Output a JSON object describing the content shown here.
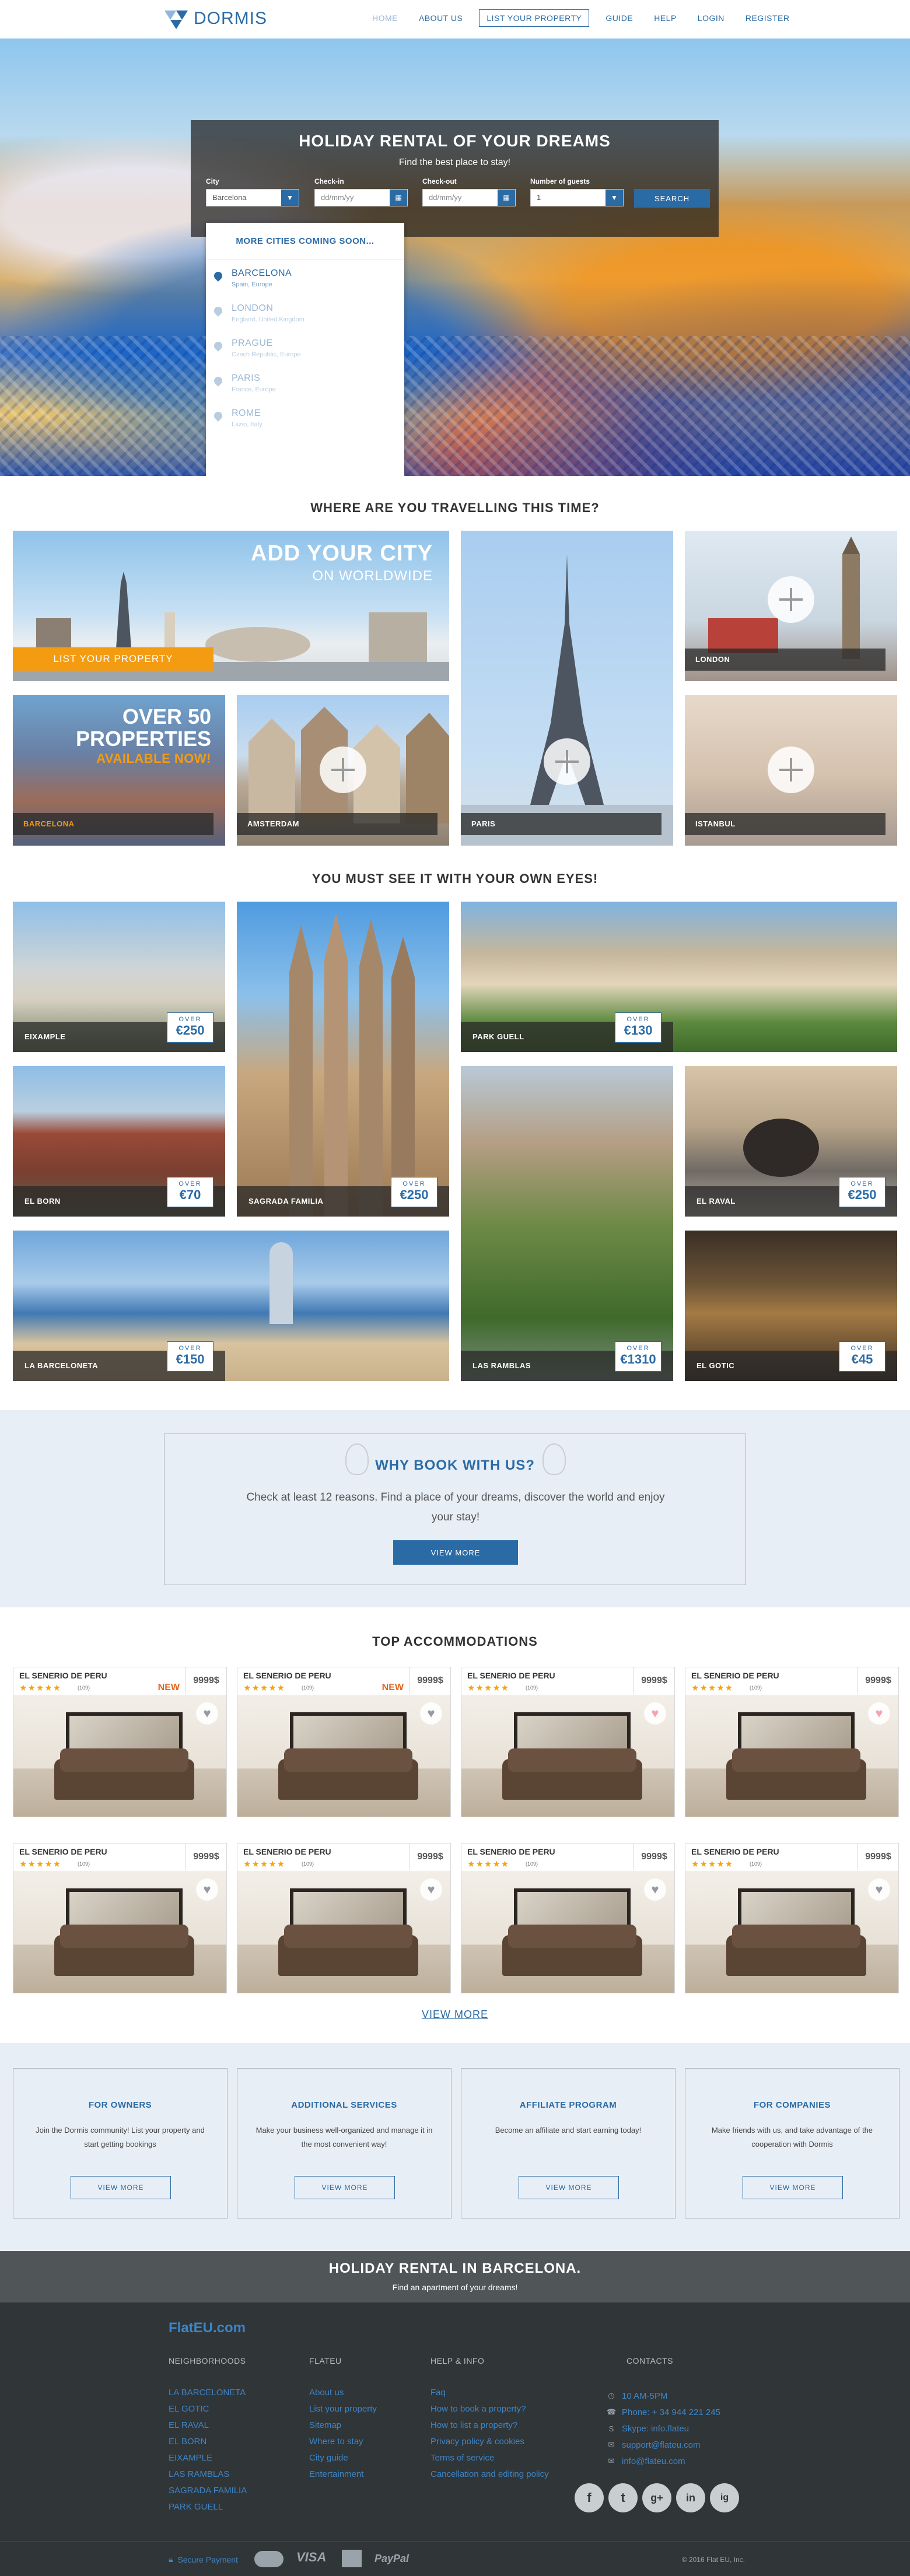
{
  "header": {
    "brand": "DORMIS",
    "nav": [
      "HOME",
      "ABOUT US",
      "LIST YOUR PROPERTY",
      "GUIDE",
      "HELP",
      "LOGIN",
      "REGISTER"
    ]
  },
  "hero": {
    "title": "HOLIDAY RENTAL OF YOUR DREAMS",
    "subtitle": "Find the best place to stay!",
    "city_label": "City",
    "city_value": "Barcelona",
    "checkin_label": "Check-in",
    "checkin_placeholder": "dd/mm/yy",
    "checkout_label": "Check-out",
    "checkout_placeholder": "dd/mm/yy",
    "guests_label": "Number of guests",
    "guests_value": "1",
    "search_button": "SEARCH",
    "dropdown_head": "MORE CITIES COMING SOON...",
    "cities": [
      {
        "name": "BARCELONA",
        "country": "Spain, Europe"
      },
      {
        "name": "LONDON",
        "country": "England, United Kingdom"
      },
      {
        "name": "PRAGUE",
        "country": "Czech Republic, Europe"
      },
      {
        "name": "PARIS",
        "country": "France, Europe"
      },
      {
        "name": "ROME",
        "country": "Lazio, Italy"
      }
    ]
  },
  "travel": {
    "heading": "WHERE ARE YOU TRAVELLING THIS TIME?",
    "add_city_title": "ADD YOUR CITY",
    "add_city_sub": "ON WORLDWIDE",
    "list_property": "LIST YOUR PROPERTY",
    "over_50_line1": "OVER 50",
    "over_50_line2": "PROPERTIES",
    "over_50_line3": "AVAILABLE NOW!",
    "tiles": [
      "BARCELONA",
      "AMSTERDAM",
      "PARIS",
      "LONDON",
      "ISTANBUL"
    ]
  },
  "see": {
    "heading": "YOU MUST SEE IT WITH YOUR OWN EYES!",
    "over": "OVER",
    "places": [
      {
        "name": "EIXAMPLE",
        "price": "€250"
      },
      {
        "name": "SAGRADA FAMILIA",
        "price": "€250"
      },
      {
        "name": "PARK GUELL",
        "price": "€130"
      },
      {
        "name": "EL BORN",
        "price": "€70"
      },
      {
        "name": "LAS RAMBLAS",
        "price": "€1310"
      },
      {
        "name": "EL RAVAL",
        "price": "€250"
      },
      {
        "name": "LA BARCELONETA",
        "price": "€150"
      },
      {
        "name": "EL GOTIC",
        "price": "€45"
      }
    ]
  },
  "why": {
    "title": "WHY BOOK WITH US?",
    "text": "Check at least 12 reasons. Find a place of your dreams, discover the world and enjoy your stay!",
    "button": "VIEW MORE"
  },
  "accommodations": {
    "heading": "TOP ACCOMMODATIONS",
    "stars": "★★★★★",
    "reviews": "(109)",
    "new_label": "NEW",
    "cards": [
      {
        "name": "EL SENERIO DE PERU",
        "price": "9999$",
        "new": true,
        "fav": false
      },
      {
        "name": "EL SENERIO DE PERU",
        "price": "9999$",
        "new": true,
        "fav": false
      },
      {
        "name": "EL SENERIO DE PERU",
        "price": "9999$",
        "new": false,
        "fav": true
      },
      {
        "name": "EL SENERIO DE PERU",
        "price": "9999$",
        "new": false,
        "fav": true
      },
      {
        "name": "EL SENERIO DE PERU",
        "price": "9999$",
        "new": false,
        "fav": false
      },
      {
        "name": "EL SENERIO DE PERU",
        "price": "9999$",
        "new": false,
        "fav": false
      },
      {
        "name": "EL SENERIO DE PERU",
        "price": "9999$",
        "new": false,
        "fav": false
      },
      {
        "name": "EL SENERIO DE PERU",
        "price": "9999$",
        "new": false,
        "fav": false
      }
    ],
    "view_more": "VIEW MORE"
  },
  "info": [
    {
      "title": "FOR OWNERS",
      "text": "Join the Dormis community! List your property and start getting bookings",
      "button": "VIEW MORE"
    },
    {
      "title": "ADDITIONAL SERVICES",
      "text": "Make your business well-organized and manage it in the most convenient way!",
      "button": "VIEW MORE"
    },
    {
      "title": "AFFILIATE PROGRAM",
      "text": "Become an affiliate and start earning today!",
      "button": "VIEW MORE"
    },
    {
      "title": "FOR COMPANIES",
      "text": "Make friends with us, and take advantage of the cooperation with Dormis",
      "button": "VIEW MORE"
    }
  ],
  "banner": {
    "title": "HOLIDAY RENTAL IN BARCELONA.",
    "subtitle": "Find an apartment of your dreams!"
  },
  "footer": {
    "logo": "FlatEU.com",
    "neighborhoods_title": "NEIGHBORHOODS",
    "neighborhoods": [
      "LA BARCELONETA",
      "EL GOTIC",
      "EL RAVAL",
      "EL BORN",
      "EIXAMPLE",
      "LAS RAMBLAS",
      "SAGRADA FAMILIA",
      "PARK GUELL"
    ],
    "flateu_title": "FLATEU",
    "flateu": [
      "About us",
      "List your property",
      "Sitemap",
      "Where to stay",
      "City guide",
      "Entertainment"
    ],
    "help_title": "HELP & INFO",
    "help": [
      "Faq",
      "How to book a property?",
      "How to list a property?",
      "Privacy policy & cookies",
      "Terms of service",
      "Cancellation and editing policy"
    ],
    "contacts_title": "CONTACTS",
    "contacts": [
      "10 AM-5PM",
      "Phone: + 34 944 221 245",
      "Skype: info.flateu",
      "support@flateu.com",
      "info@flateu.com"
    ],
    "social": [
      "f",
      "t",
      "g+",
      "in",
      "ig"
    ],
    "secure": "Secure Payment",
    "visa": "VISA",
    "paypal": "PayPal",
    "copyright": "© 2016 Flat EU, Inc."
  }
}
